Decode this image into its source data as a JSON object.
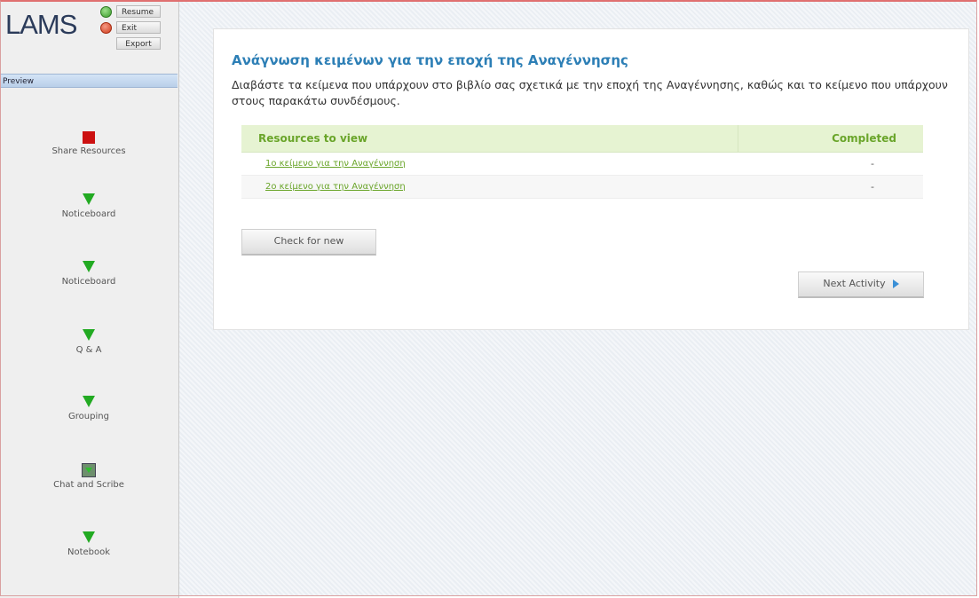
{
  "app": {
    "logo": "LAMS",
    "resume_label": "Resume",
    "exit_label": "Exit",
    "export_label": "Export",
    "preview_label": "Preview"
  },
  "sidebar": {
    "activities": [
      {
        "label": "Share Resources",
        "icon": "red-square-icon"
      },
      {
        "label": "Noticeboard",
        "icon": "green-arrow-icon"
      },
      {
        "label": "Noticeboard",
        "icon": "green-arrow-icon"
      },
      {
        "label": "Q & A",
        "icon": "green-arrow-icon"
      },
      {
        "label": "Grouping",
        "icon": "green-arrow-icon"
      },
      {
        "label": "Chat and Scribe",
        "icon": "grey-square-icon"
      },
      {
        "label": "Notebook",
        "icon": "green-arrow-icon"
      }
    ]
  },
  "main": {
    "title": "Ανάγνωση κειμένων για την εποχή της Αναγέννησης",
    "intro": "Διαβάστε τα κείμενα που υπάρχουν στο βιβλίο σας σχετικά με την εποχή της Αναγέννησης, καθώς και το κείμενο που υπάρχουν στους παρακάτω συνδέσμους.",
    "table": {
      "col_resources": "Resources to view",
      "col_completed": "Completed",
      "rows": [
        {
          "resource": "1ο κείμενο για την Αναγέννηση",
          "completed": "-"
        },
        {
          "resource": "2ο κείμενο για την Αναγέννηση",
          "completed": "-"
        }
      ]
    },
    "check_button": "Check for new",
    "next_button": "Next Activity"
  },
  "colors": {
    "title_blue": "#2d7fb6",
    "table_green": "#6aa52a",
    "table_header_bg": "#e6f3d2",
    "arrow_green": "#22aa22",
    "current_red": "#cc1111"
  }
}
